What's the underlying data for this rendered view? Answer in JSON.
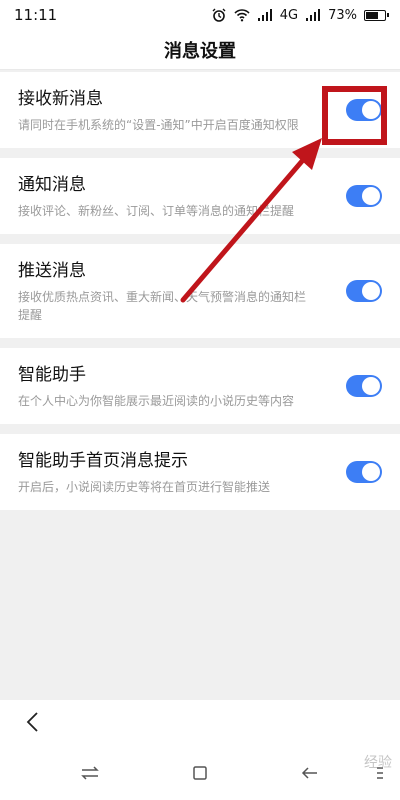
{
  "status_bar": {
    "time": "11:11",
    "network": "4G",
    "battery_percent": "73%",
    "battery_level": 0.73,
    "icons": [
      "alarm-icon",
      "wifi-icon",
      "signal-icon",
      "signal-icon",
      "battery-icon"
    ]
  },
  "header": {
    "title": "消息设置"
  },
  "settings": [
    {
      "title": "接收新消息",
      "desc": "请同时在手机系统的“设置-通知”中开启百度通知权限",
      "enabled": true
    },
    {
      "title": "通知消息",
      "desc": "接收评论、新粉丝、订阅、订单等消息的通知栏提醒",
      "enabled": true
    },
    {
      "title": "推送消息",
      "desc": "接收优质热点资讯、重大新闻、天气预警消息的通知栏提醒",
      "enabled": true
    },
    {
      "title": "智能助手",
      "desc": "在个人中心为你智能展示最近阅读的小说历史等内容",
      "enabled": true
    },
    {
      "title": "智能助手首页消息提示",
      "desc": "开启后，小说阅读历史等将在首页进行智能推送",
      "enabled": true
    }
  ],
  "colors": {
    "toggle_on": "#3d7ef5",
    "annotation": "#c0151b"
  },
  "nav": {
    "icons": [
      "back-icon",
      "switch-icon",
      "home-square-icon",
      "return-icon",
      "menu-icon"
    ]
  },
  "watermark": "经验"
}
